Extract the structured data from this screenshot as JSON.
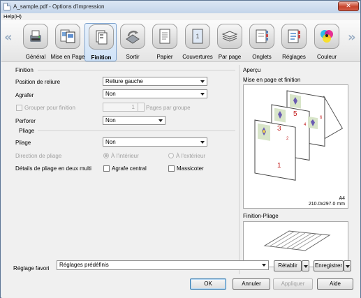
{
  "window": {
    "title": "A_sample.pdf - Options d'impression",
    "close_glyph": "✕"
  },
  "menu": {
    "help_label": "Help(H)"
  },
  "toolbar": {
    "nav_prev_glyph": "«",
    "nav_next_glyph": "»",
    "tabs": [
      {
        "label": "Général",
        "icon": "general-icon"
      },
      {
        "label": "Mise en Page",
        "icon": "layout-icon"
      },
      {
        "label": "Finition",
        "icon": "finishing-icon",
        "selected": true
      },
      {
        "label": "Sortir",
        "icon": "output-icon"
      },
      {
        "label": "Papier",
        "icon": "paper-icon"
      },
      {
        "label": "Couvertures",
        "icon": "cover-icon"
      },
      {
        "label": "Par page",
        "icon": "per-page-icon"
      },
      {
        "label": "Onglets",
        "icon": "tabs-icon"
      },
      {
        "label": "Réglages",
        "icon": "settings-icon"
      },
      {
        "label": "Couleur",
        "icon": "color-icon"
      }
    ]
  },
  "finition": {
    "section_title": "Finition",
    "binding_position": {
      "label": "Position de reliure",
      "value": "Reliure gauche"
    },
    "staple": {
      "label": "Agrafer",
      "value": "Non"
    },
    "group": {
      "label": "Grouper pour finition",
      "count": "1",
      "unit": "Pages par groupe"
    },
    "punch": {
      "label": "Perforer",
      "value": "Non"
    }
  },
  "pliage": {
    "section_title": "Pliage",
    "fold": {
      "label": "Pliage",
      "value": "Non"
    },
    "direction": {
      "label": "Direction de pliage",
      "inside": "À l'intérieur",
      "outside": "À l'extérieur"
    },
    "bifold": {
      "label": "Détails de pliage en deux multi",
      "center_staple": "Agrafe central",
      "trim": "Massicoter"
    }
  },
  "apercu": {
    "section_title": "Aperçu",
    "layout_title": "Mise en page et finition",
    "paper_size": "A4",
    "paper_dims": "210.0x297.0 mm",
    "page_numbers": [
      "1",
      "3",
      "5",
      "2",
      "4",
      "6"
    ],
    "fold_title": "Finition-Pliage"
  },
  "favorites": {
    "label": "Réglage favori",
    "value": "Réglages prédéfinis",
    "restore_label": "Rétablir",
    "save_label": "Enregistrer"
  },
  "buttons": {
    "ok": "OK",
    "cancel": "Annuler",
    "apply": "Appliquer",
    "help": "Aide"
  },
  "colors": {
    "accent_red": "#c42020",
    "selection_blue": "#cfe2f7"
  }
}
